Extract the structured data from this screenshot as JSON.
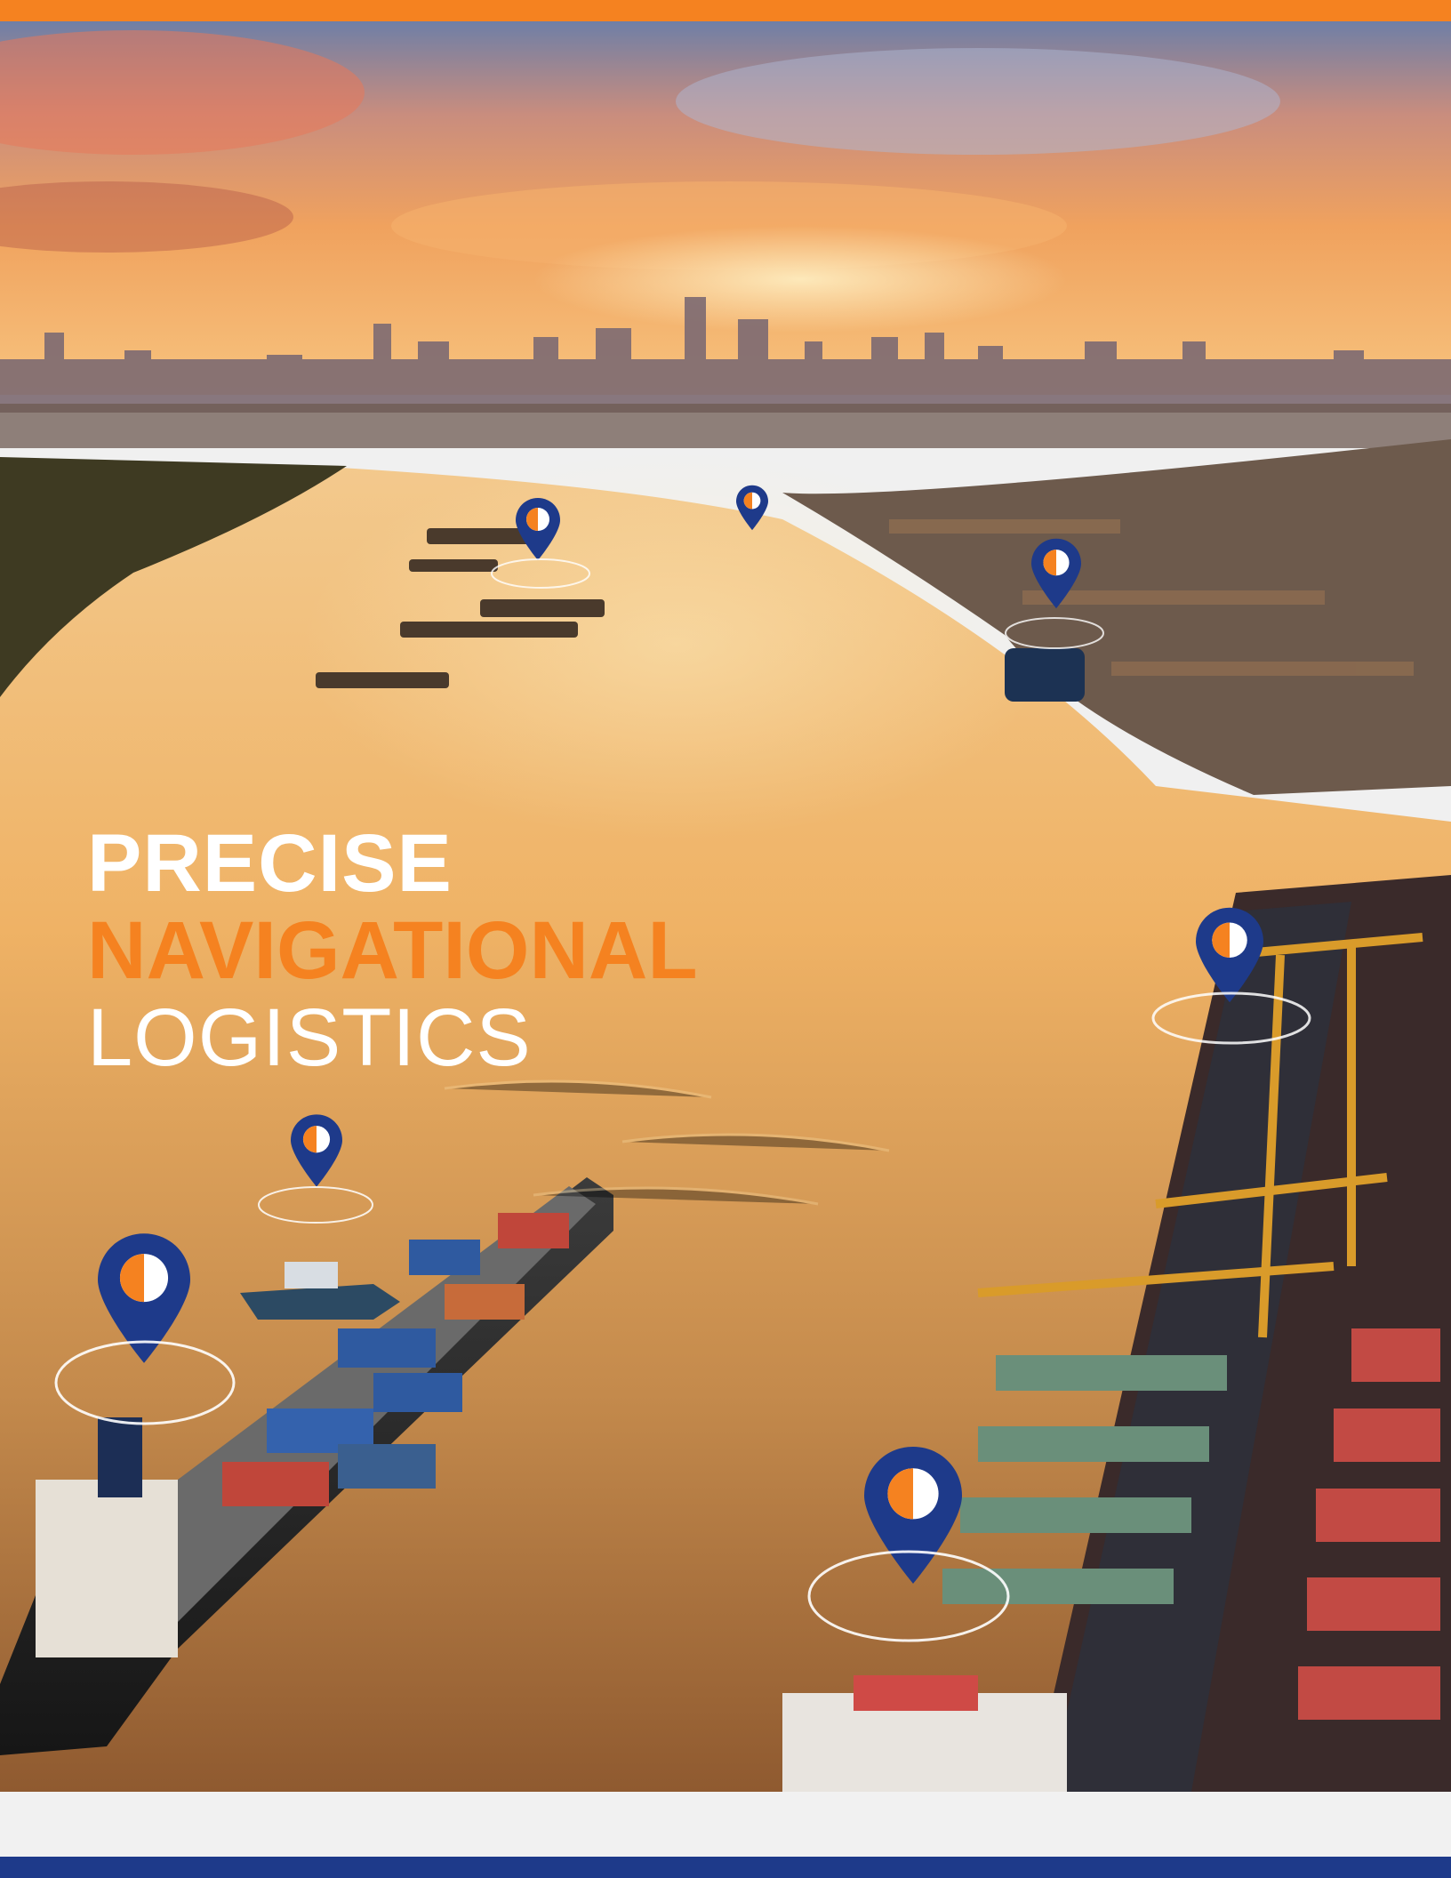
{
  "headline": {
    "line1": "PRECISE",
    "line2": "NAVIGATIONAL",
    "line3": "LOGISTICS"
  },
  "colors": {
    "accent_orange": "#f58220",
    "brand_blue": "#1e3a8a",
    "headline_white": "#ffffff",
    "footer_gray": "#f1f1f1"
  },
  "icons": {
    "pin": "map-pin-icon",
    "logo_mark": "brand-logo-icon",
    "target": "target-reticle-icon"
  }
}
